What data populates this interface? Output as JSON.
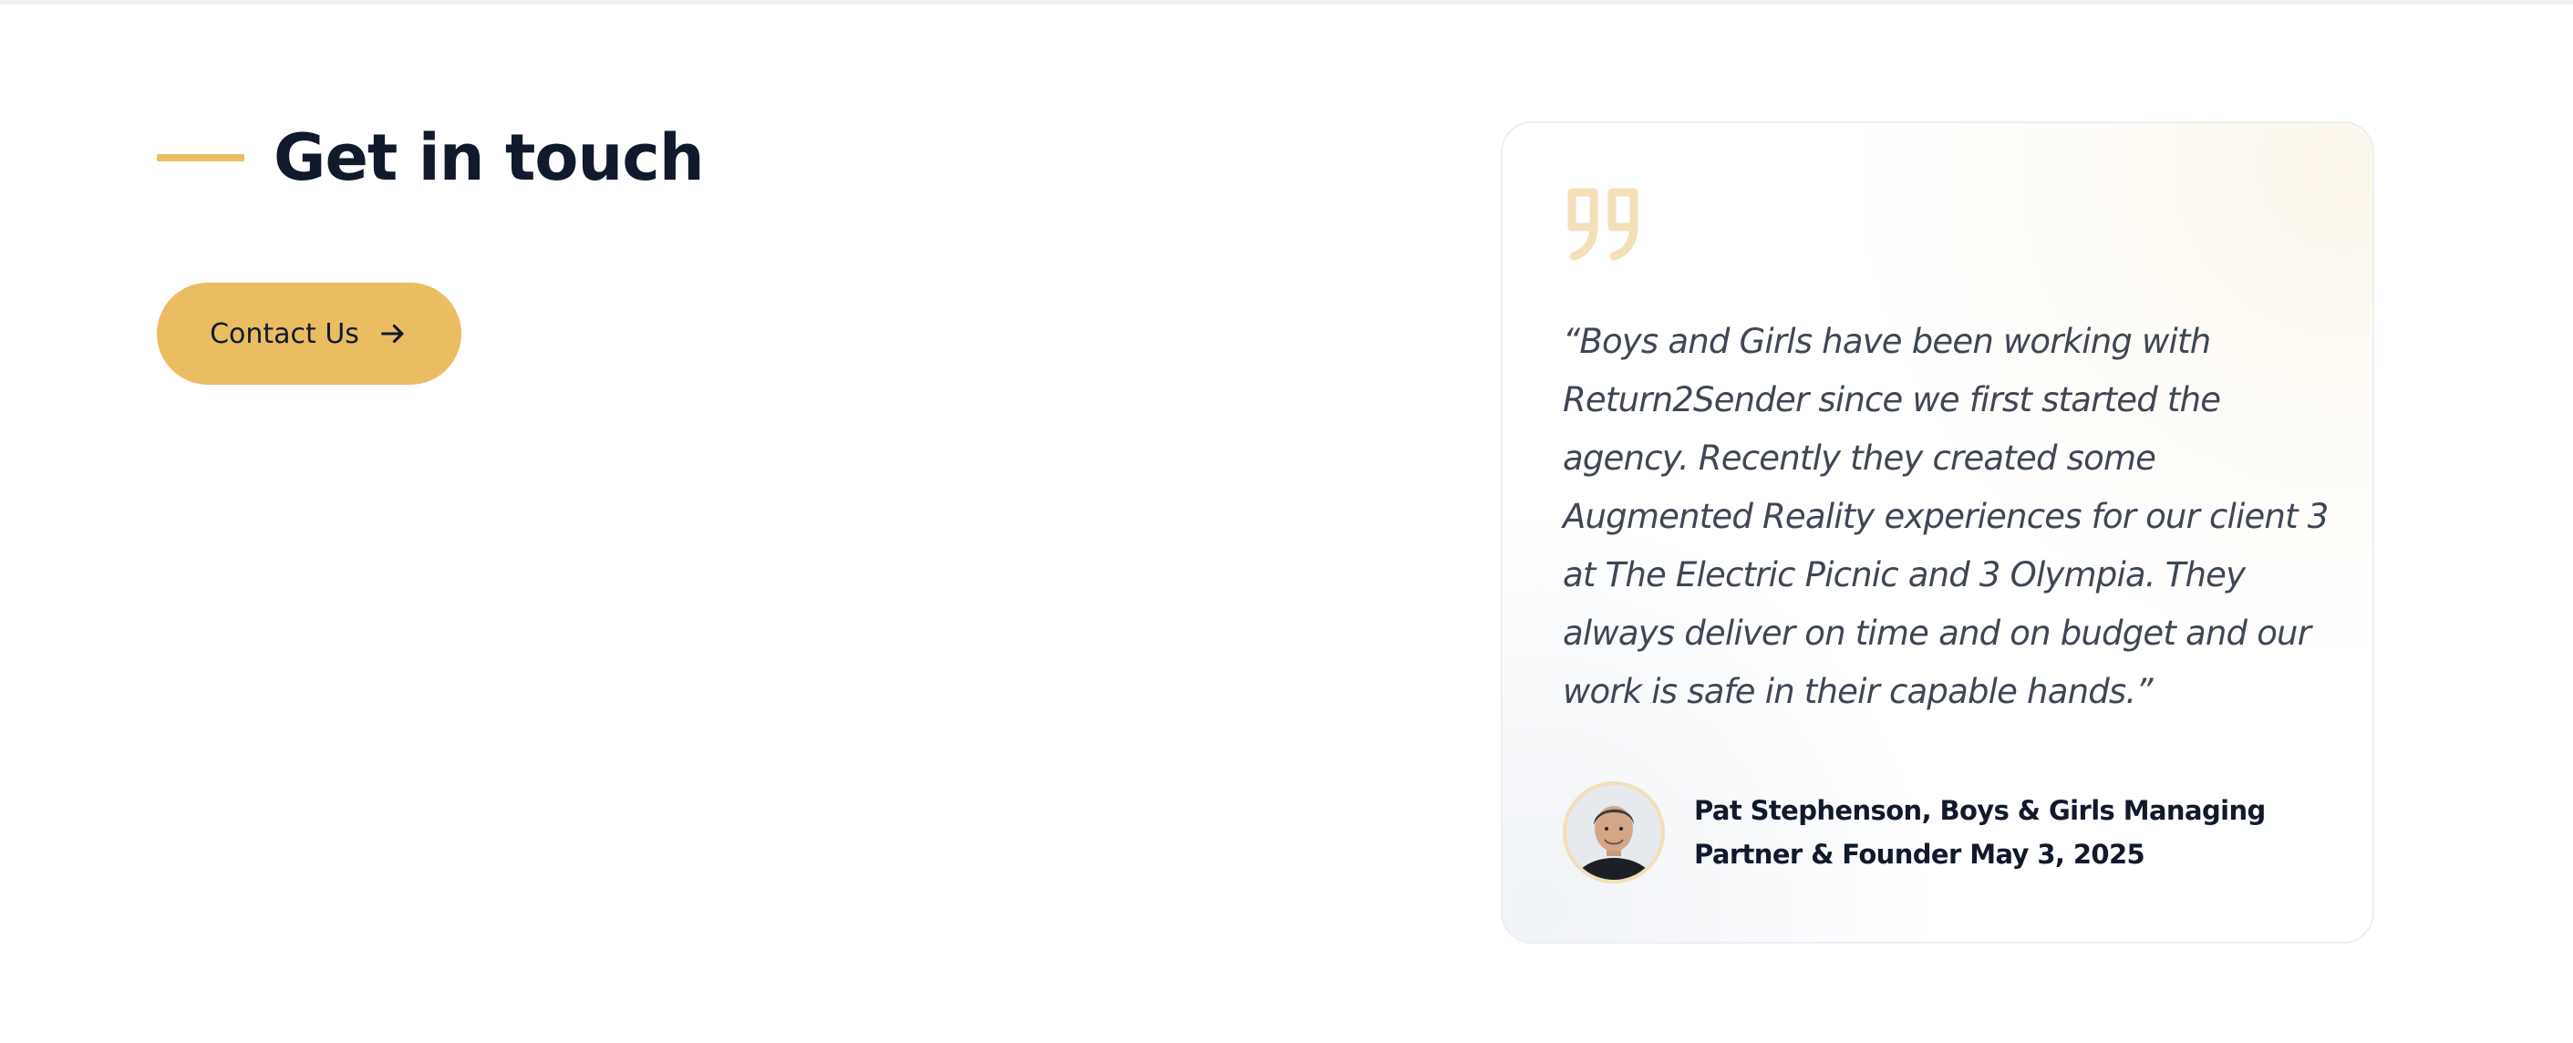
{
  "section": {
    "title": "Get in touch",
    "accent_color": "#ebbd63"
  },
  "contact_button": {
    "label": "Contact Us",
    "icon": "arrow-right-icon",
    "color": "#ebbd63"
  },
  "testimonial": {
    "quote_icon": "quote-icon",
    "quote": "“Boys and Girls have been working with Return2Sender since we first started the agency. Recently they created some Augmented Reality experiences for our client 3 at The Electric Picnic and 3 Olympia. They always deliver on time and on budget and our work is safe in their capable hands.”",
    "author": "Pat Stephenson, Boys & Girls Managing Partner & Founder",
    "date": "May 3, 2025"
  }
}
